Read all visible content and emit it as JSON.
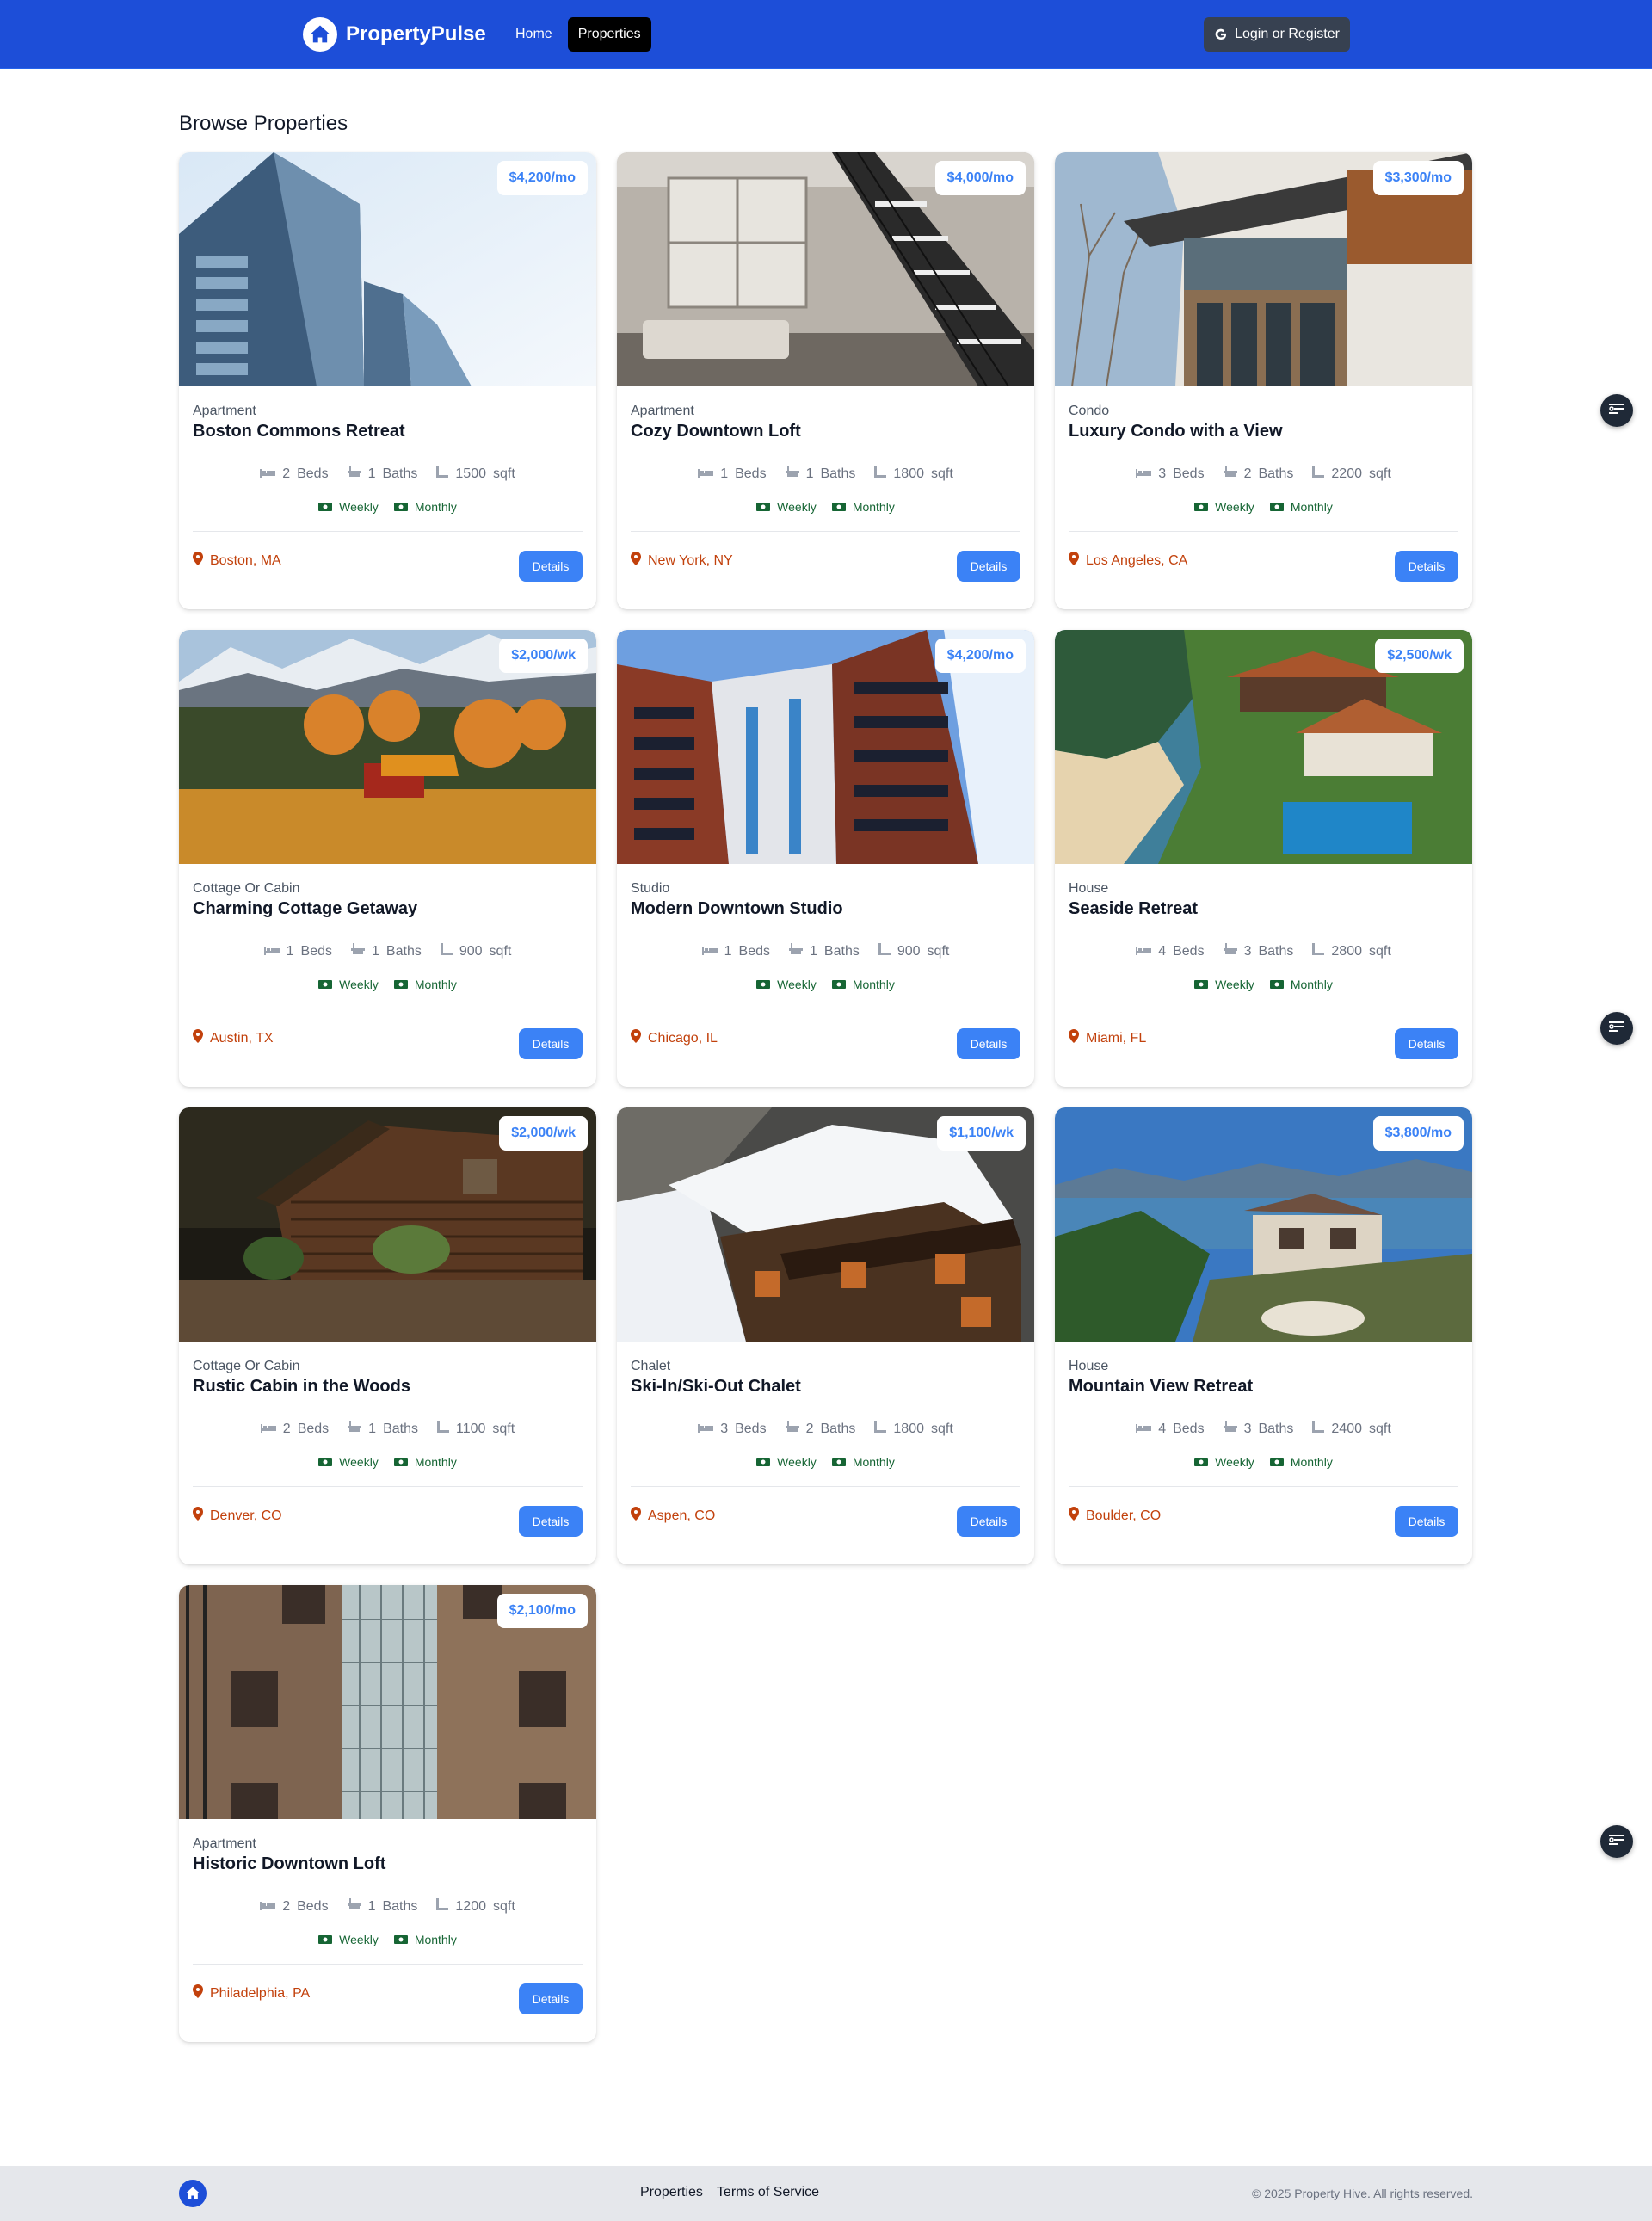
{
  "nav": {
    "brand": "PropertyPulse",
    "links": [
      {
        "label": "Home",
        "active": false
      },
      {
        "label": "Properties",
        "active": true
      }
    ],
    "login_label": "Login or Register"
  },
  "page_title": "Browse Properties",
  "labels": {
    "beds": "Beds",
    "baths": "Baths",
    "sqft": "sqft",
    "weekly": "Weekly",
    "monthly": "Monthly",
    "details": "Details"
  },
  "properties": [
    {
      "type": "Apartment",
      "name": "Boston Commons Retreat",
      "rate": "$4,200/mo",
      "beds": "2",
      "baths": "1",
      "sqft": "1500",
      "location": "Boston, MA"
    },
    {
      "type": "Apartment",
      "name": "Cozy Downtown Loft",
      "rate": "$4,000/mo",
      "beds": "1",
      "baths": "1",
      "sqft": "1800",
      "location": "New York, NY"
    },
    {
      "type": "Condo",
      "name": "Luxury Condo with a View",
      "rate": "$3,300/mo",
      "beds": "3",
      "baths": "2",
      "sqft": "2200",
      "location": "Los Angeles, CA"
    },
    {
      "type": "Cottage Or Cabin",
      "name": "Charming Cottage Getaway",
      "rate": "$2,000/wk",
      "beds": "1",
      "baths": "1",
      "sqft": "900",
      "location": "Austin, TX"
    },
    {
      "type": "Studio",
      "name": "Modern Downtown Studio",
      "rate": "$4,200/mo",
      "beds": "1",
      "baths": "1",
      "sqft": "900",
      "location": "Chicago, IL"
    },
    {
      "type": "House",
      "name": "Seaside Retreat",
      "rate": "$2,500/wk",
      "beds": "4",
      "baths": "3",
      "sqft": "2800",
      "location": "Miami, FL"
    },
    {
      "type": "Cottage Or Cabin",
      "name": "Rustic Cabin in the Woods",
      "rate": "$2,000/wk",
      "beds": "2",
      "baths": "1",
      "sqft": "1100",
      "location": "Denver, CO"
    },
    {
      "type": "Chalet",
      "name": "Ski-In/Ski-Out Chalet",
      "rate": "$1,100/wk",
      "beds": "3",
      "baths": "2",
      "sqft": "1800",
      "location": "Aspen, CO"
    },
    {
      "type": "House",
      "name": "Mountain View Retreat",
      "rate": "$3,800/mo",
      "beds": "4",
      "baths": "3",
      "sqft": "2400",
      "location": "Boulder, CO"
    },
    {
      "type": "Apartment",
      "name": "Historic Downtown Loft",
      "rate": "$2,100/mo",
      "beds": "2",
      "baths": "1",
      "sqft": "1200",
      "location": "Philadelphia, PA"
    }
  ],
  "footer": {
    "links": [
      "Properties",
      "Terms of Service"
    ],
    "copyright": "© 2025 Property Hive. All rights reserved."
  },
  "colors": {
    "nav_bg": "#1d4ed8",
    "accent": "#3b82f6",
    "location": "#c2410c",
    "rate_option": "#166534"
  },
  "icons": [
    "home-icon",
    "google-icon",
    "bed-icon",
    "bath-icon",
    "ruler-icon",
    "money-icon",
    "map-pin-icon",
    "filter-icon"
  ]
}
